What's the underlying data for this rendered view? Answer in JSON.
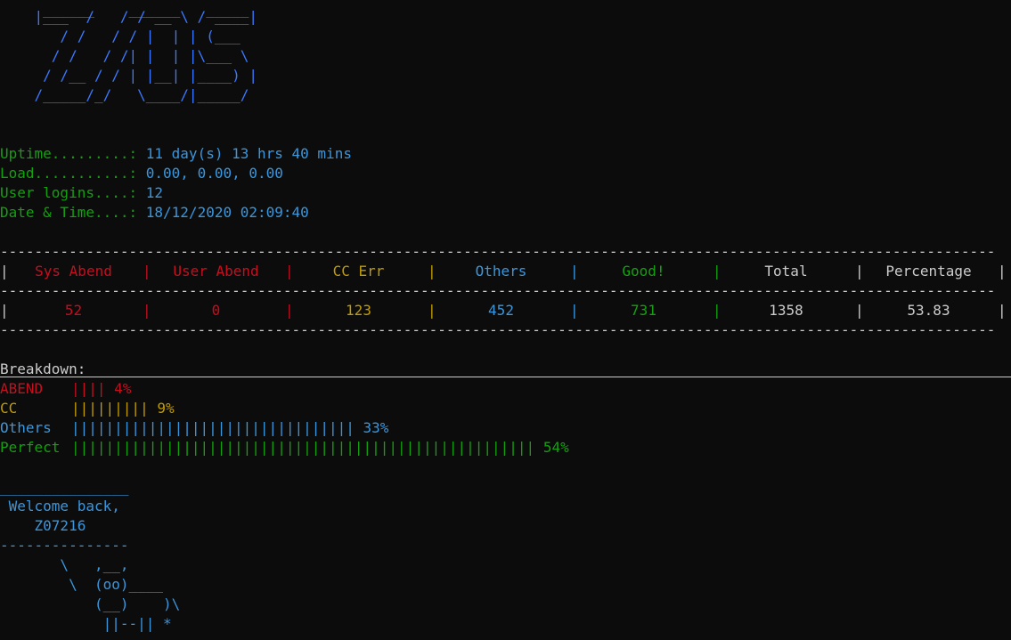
{
  "logo_lines": [
    "     ______    ______   _____",
    "    |___  /   / / __ \\ / ____|",
    "       / /   / / |  | | (___",
    "      / /   / /| |  | |\\___ \\",
    "     / /__ / / | |__| |____) |",
    "    /_____/_/   \\____/|_____/"
  ],
  "info": [
    {
      "label": "Uptime.........: ",
      "value": "11 day(s) 13 hrs 40 mins"
    },
    {
      "label": "Load...........: ",
      "value": "0.00, 0.00, 0.00"
    },
    {
      "label": "User logins....: ",
      "value": "12"
    },
    {
      "label": "Date & Time....: ",
      "value": "18/12/2020 02:09:40"
    }
  ],
  "dash_line": "--------------------------------------------------------------------------------------------------------------------",
  "table": {
    "headers": [
      "Sys Abend",
      "User Abend",
      "CC Err",
      "Others",
      "Good!",
      "Total",
      "Percentage"
    ],
    "values": [
      "52",
      "0",
      "123",
      "452",
      "731",
      "1358",
      "53.83"
    ],
    "colors": {
      "sys_abend": "#c50f1f",
      "user_abend": "#c50f1f",
      "cc_err": "#c19c00",
      "others": "#3a96dd",
      "good": "#13a10e",
      "total": "#cccccc",
      "percentage": "#cccccc"
    }
  },
  "breakdown": {
    "title": "Breakdown:",
    "rows": [
      {
        "label": "ABEND",
        "bars": "||||",
        "percent": "4%",
        "value": 4
      },
      {
        "label": "CC",
        "bars": "|||||||||",
        "percent": "9%",
        "value": 9
      },
      {
        "label": "Others",
        "bars": "|||||||||||||||||||||||||||||||||",
        "percent": "33%",
        "value": 33
      },
      {
        "label": "Perfect",
        "bars": "||||||||||||||||||||||||||||||||||||||||||||||||||||||",
        "percent": "54%",
        "value": 54
      }
    ]
  },
  "welcome": {
    "top_line": "_______________",
    "greeting": " Welcome back,",
    "user": "    Z07216",
    "bottom_line": "---------------"
  },
  "cow_lines": [
    "       \\   ,__,",
    "        \\  (oo)____",
    "           (__)    )\\",
    "            ||--|| *"
  ],
  "theme_colors": {
    "background": "#0c0c0c",
    "logo": "#3b78ff",
    "label_green": "#13a10e",
    "value_blue": "#3a96dd",
    "red": "#c50f1f",
    "yellow": "#c19c00",
    "white": "#cccccc"
  }
}
